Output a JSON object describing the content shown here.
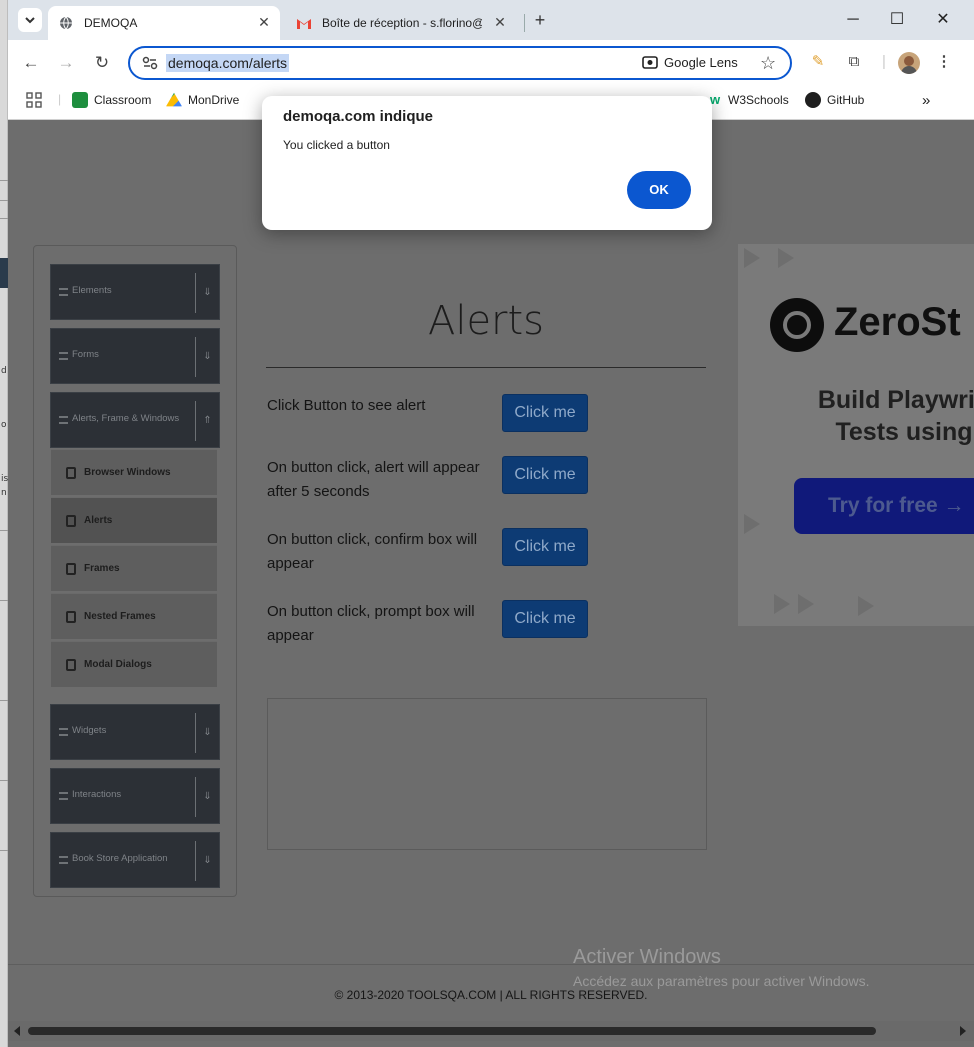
{
  "browser": {
    "tabs": [
      {
        "title": "DEMOQA",
        "active": true,
        "icon": "globe-icon"
      },
      {
        "title": "Boîte de réception - s.florino@",
        "active": false,
        "icon": "gmail-icon"
      }
    ],
    "url": "demoqa.com/alerts",
    "lens_label": "Google Lens",
    "bookmarks": [
      {
        "label": "Classroom",
        "icon": "classroom-icon"
      },
      {
        "label": "MonDrive",
        "icon": "drive-icon"
      },
      {
        "label": "W3Schools",
        "icon": "w3schools-icon"
      },
      {
        "label": "GitHub",
        "icon": "github-icon"
      }
    ],
    "more_bookmarks": "»"
  },
  "dialog": {
    "title": "demoqa.com indique",
    "message": "You clicked a button",
    "ok_label": "OK"
  },
  "sidebar": {
    "groups": [
      {
        "label": "Elements"
      },
      {
        "label": "Forms"
      },
      {
        "label": "Alerts, Frame & Windows"
      },
      {
        "label": "Widgets"
      },
      {
        "label": "Interactions"
      },
      {
        "label": "Book Store Application"
      }
    ],
    "subitems": [
      {
        "label": "Browser Windows"
      },
      {
        "label": "Alerts",
        "active": true
      },
      {
        "label": "Frames"
      },
      {
        "label": "Nested Frames"
      },
      {
        "label": "Modal Dialogs"
      }
    ]
  },
  "main": {
    "title": "Alerts",
    "rows": [
      {
        "text": "Click Button to see alert",
        "button": "Click me"
      },
      {
        "text": "On button click, alert will appear after 5 seconds",
        "button": "Click me"
      },
      {
        "text": "On button click, confirm box will appear",
        "button": "Click me"
      },
      {
        "text": "On button click, prompt box will appear",
        "button": "Click me"
      }
    ]
  },
  "ad": {
    "brand": "ZeroSt",
    "tagline": "Build Playwrig Tests using",
    "cta": "Try for free →"
  },
  "watermark": {
    "line1": "Activer Windows",
    "line2": "Accédez aux paramètres pour activer Windows."
  },
  "footer": "© 2013-2020 TOOLSQA.COM | ALL RIGHTS RESERVED.",
  "left_strip_chars": [
    "d",
    "o",
    "is",
    "n"
  ],
  "colors": {
    "accent": "#0b57d0",
    "button": "#0d3b74",
    "sidebar_group": "#2c3036"
  }
}
